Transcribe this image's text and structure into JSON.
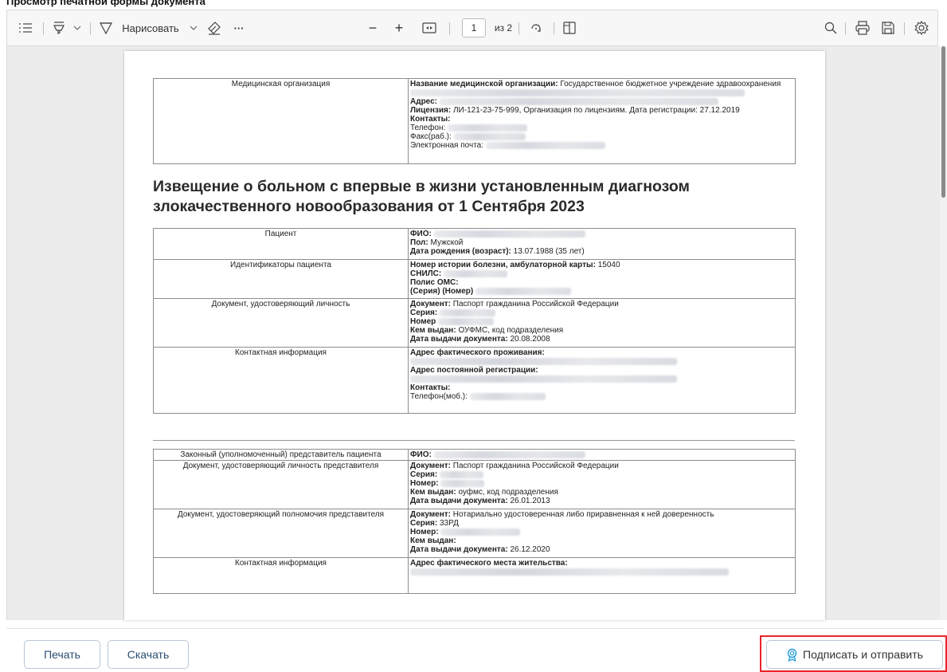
{
  "top_strip_text": "Просмотр печатной формы документа",
  "toolbar": {
    "draw_label": "Нарисовать",
    "more_label": "···",
    "zoom_out": "−",
    "zoom_in": "+",
    "page_current": "1",
    "page_total": "из 2"
  },
  "document": {
    "org_table": {
      "left_label": "Медицинская организация",
      "org_name_key": "Название медицинской организации:",
      "org_name_val": "Государственное бюджетное учреждение здравоохранения",
      "address_key": "Адрес:",
      "license_key": "Лицензия:",
      "license_val": "ЛИ-121-23-75-999, Организация по лицензиям. Дата регистрации: 27.12.2019",
      "contacts_key": "Контакты:",
      "phone_key": "Телефон:",
      "fax_key": "Факс(раб.):",
      "email_key": "Электронная почта:"
    },
    "heading": "Извещение о больном с впервые в жизни установленным диагнозом злокачественного новообразования от 1 Сентября 2023",
    "patient_table": {
      "patient_label": "Пациент",
      "fio_key": "ФИО:",
      "sex_key": "Пол:",
      "sex_val": "Мужской",
      "dob_key": "Дата рождения (возраст):",
      "dob_val": "13.07.1988 (35 лет)",
      "ids_label": "Идентификаторы пациента",
      "card_key": "Номер истории болезни, амбулаторной карты:",
      "card_val": "15040",
      "snils_key": "СНИЛС:",
      "oms_key": "Полис ОМС:",
      "series_num_key": "(Серия) (Номер)",
      "doc_label": "Документ, удостоверяющий личность",
      "doc_key": "Документ:",
      "doc_val": "Паспорт гражданина Российской Федерации",
      "series_key": "Серия:",
      "number_key": "Номер",
      "issued_key": "Кем выдан:",
      "issued_val": "ОУФМС, код подразделения",
      "issue_date_key": "Дата выдачи документа:",
      "issue_date_val": "20.08.2008",
      "contact_label": "Контактная информация",
      "actual_addr_key": "Адрес фактического проживания:",
      "reg_addr_key": "Адрес постоянной регистрации:",
      "contacts_key": "Контакты:",
      "mobile_key": "Телефон(моб.):"
    },
    "rep_table": {
      "rep_label": "Законный (уполномоченный) представитель пациента",
      "fio_key": "ФИО:",
      "rep_doc_label": "Документ, удостоверяющий личность представителя",
      "doc_key": "Документ:",
      "doc_val": "Паспорт гражданина Российской Федерации",
      "series_key": "Серия:",
      "number_key": "Номер:",
      "issued_key": "Кем выдан:",
      "issued_val": "оуфмс, код подразделения",
      "issue_date_key": "Дата выдачи документа:",
      "issue_date_val": "26.01.2013",
      "power_label": "Документ, удостоверяющий полномочия представителя",
      "power_doc_val": "Нотариально удостоверенная либо приравненная к ней доверенность",
      "power_series_val": "33РД",
      "power_issued_key": "Кем выдан:",
      "power_date_val": "26.12.2020",
      "contact_label": "Контактная информация",
      "actual_addr_key": "Адрес фактического места жительства:"
    }
  },
  "footer": {
    "print_label": "Печать",
    "download_label": "Скачать",
    "sign_label": "Подписать и отправить"
  },
  "colors": {
    "highlight": "#e8232a",
    "button_text": "#2b4d73",
    "sign_icon": "#1e9bd7"
  }
}
